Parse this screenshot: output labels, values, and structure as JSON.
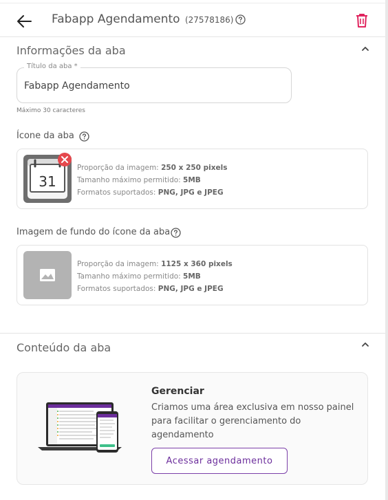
{
  "header": {
    "title": "Fabapp Agendamento",
    "app_id": "(27578186)",
    "back_icon": "arrow-left-icon",
    "help_icon": "question-circle-icon",
    "delete_icon": "trash-icon"
  },
  "tab_info": {
    "section_title": "Informações da aba",
    "name_field": {
      "label": "Título da aba *",
      "value": "Fabapp Agendamento",
      "hint": "Máximo 30 caracteres"
    },
    "icon": {
      "label": "Ícone da aba",
      "calendar_day": "31",
      "proportion_label": "Proporção da imagem:",
      "proportion_value": "250 x 250 pixels",
      "max_size_label": "Tamanho máximo permitido:",
      "max_size_value": "5MB",
      "formats_label": "Formatos suportados:",
      "formats_value": "PNG, JPG e JPEG"
    },
    "background": {
      "label": "Imagem de fundo do ícone da aba",
      "proportion_label": "Proporção da imagem:",
      "proportion_value": "1125 x 360 pixels",
      "max_size_label": "Tamanho máximo permitido:",
      "max_size_value": "5MB",
      "formats_label": "Formatos suportados:",
      "formats_value": "PNG, JPG e JPEG"
    }
  },
  "tab_content": {
    "section_title": "Conteúdo da aba",
    "manage": {
      "title": "Gerenciar",
      "description": "Criamos uma área exclusiva em nosso painel para facilitar o gerenciamento do agendamento",
      "button_label": "Acessar agendamento"
    }
  },
  "colors": {
    "accent_purple": "#7b3fa8",
    "delete_pink": "#e0245e",
    "remove_badge": "#e5484d"
  }
}
